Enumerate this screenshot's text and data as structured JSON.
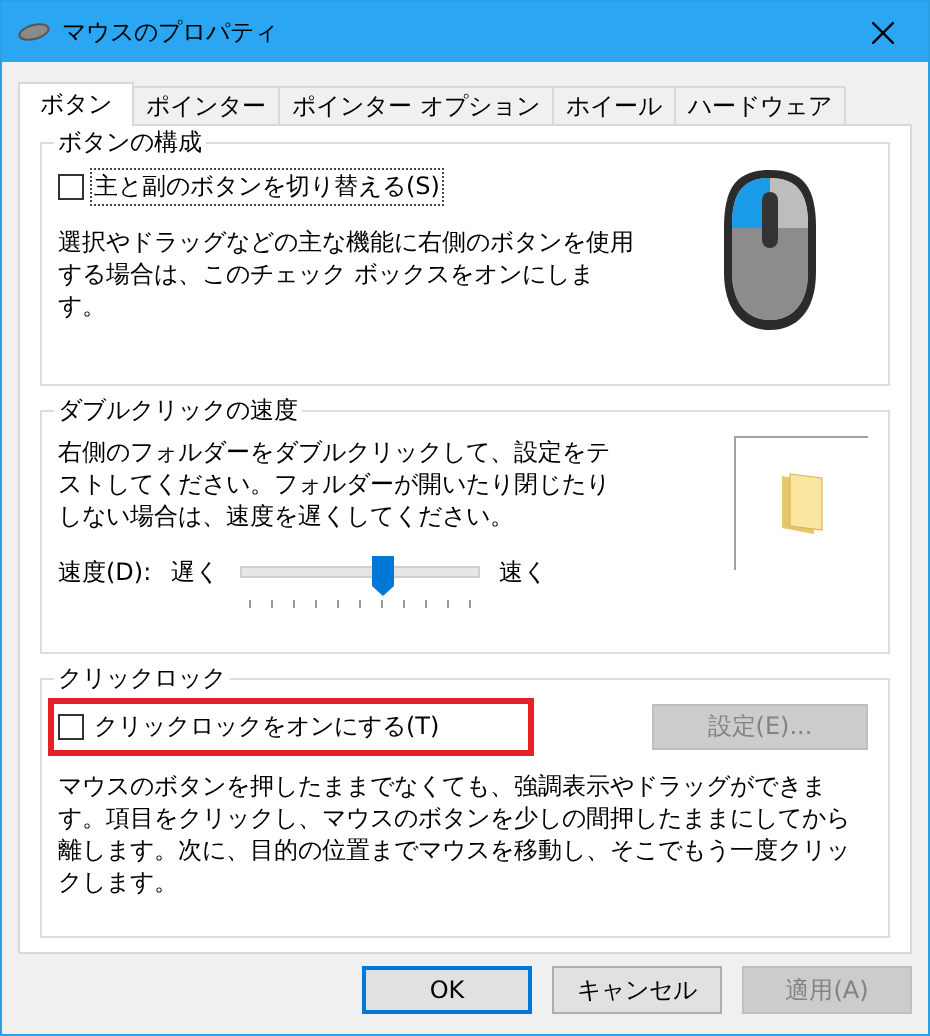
{
  "window": {
    "title": "マウスのプロパティ"
  },
  "tabs": [
    {
      "label": "ボタン",
      "selected": true
    },
    {
      "label": "ポインター",
      "selected": false
    },
    {
      "label": "ポインター オプション",
      "selected": false
    },
    {
      "label": "ホイール",
      "selected": false
    },
    {
      "label": "ハードウェア",
      "selected": false
    }
  ],
  "button_config": {
    "title": "ボタンの構成",
    "checkbox": {
      "label": "主と副のボタンを切り替える(S)",
      "checked": false,
      "focused": true
    },
    "description": "選択やドラッグなどの主な機能に右側のボタンを使用する場合は、このチェック ボックスをオンにします。"
  },
  "double_click": {
    "title": "ダブルクリックの速度",
    "description": "右側のフォルダーをダブルクリックして、設定をテストしてください。フォルダーが開いたり閉じたりしない場合は、速度を遅くしてください。",
    "speed_label": "速度(D):",
    "slow_label": "遅く",
    "fast_label": "速く",
    "level": 0.6
  },
  "click_lock": {
    "title": "クリックロック",
    "checkbox": {
      "label": "クリックロックをオンにする(T)",
      "checked": false,
      "highlighted": true
    },
    "settings_button": {
      "label": "設定(E)...",
      "disabled": true
    },
    "description": "マウスのボタンを押したままでなくても、強調表示やドラッグができます。項目をクリックし、マウスのボタンを少しの間押したままにしてから離します。次に、目的の位置までマウスを移動し、そこでもう一度クリックします。"
  },
  "buttons": [
    {
      "label": "OK",
      "default": true,
      "disabled": false
    },
    {
      "label": "キャンセル",
      "default": false,
      "disabled": false
    },
    {
      "label": "適用(A)",
      "default": false,
      "disabled": true
    }
  ]
}
